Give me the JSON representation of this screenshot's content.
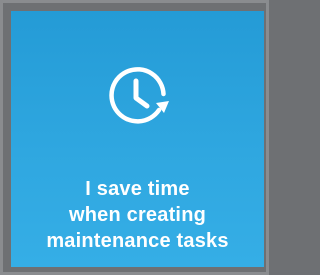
{
  "card": {
    "icon": "clock-refresh-icon",
    "caption_lines": [
      "I save time",
      "when creating",
      "maintenance tasks"
    ],
    "colors": {
      "card_top": "#249bd6",
      "card_bottom": "#35aee6",
      "frame": "#6e7073",
      "text": "#ffffff"
    }
  }
}
